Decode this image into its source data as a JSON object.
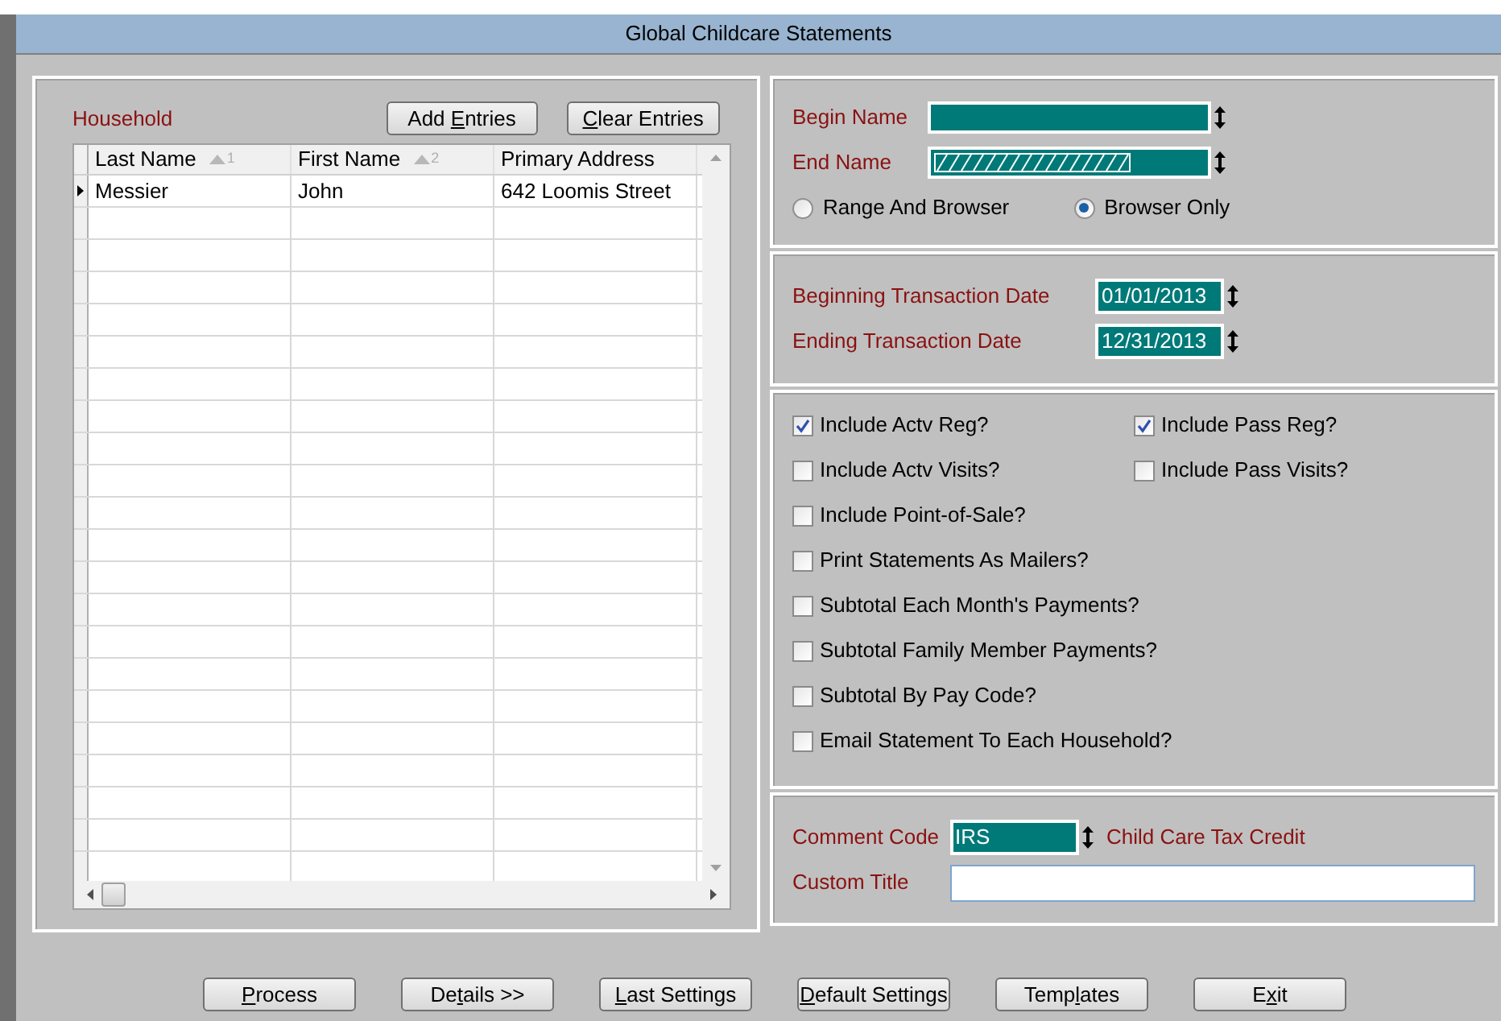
{
  "window": {
    "title": "Global Childcare Statements"
  },
  "household": {
    "label": "Household",
    "buttons": [
      {
        "pre": "Add ",
        "key": "E",
        "post": "ntries"
      },
      {
        "key": "C",
        "post": "lear Entries"
      }
    ],
    "columns": [
      {
        "label": "Last Name",
        "sort": "1"
      },
      {
        "label": "First Name",
        "sort": "2"
      },
      {
        "label": "Primary Address"
      }
    ],
    "rows": [
      {
        "current": true,
        "cells": [
          "Messier",
          "John",
          "642 Loomis Street"
        ]
      }
    ]
  },
  "name_range": {
    "fields": [
      {
        "label": "Begin Name",
        "masked": false
      },
      {
        "label": "End Name",
        "masked": true
      }
    ],
    "options": [
      {
        "label": "Range And Browser",
        "selected": false
      },
      {
        "label": "Browser Only",
        "selected": true
      }
    ]
  },
  "dates": [
    {
      "label": "Beginning Transaction Date",
      "value": "01/01/2013"
    },
    {
      "label": "Ending Transaction Date",
      "value": "12/31/2013"
    }
  ],
  "options": [
    [
      {
        "label": "Include Actv Reg?",
        "checked": true
      },
      {
        "label": "Include Pass Reg?",
        "checked": true
      }
    ],
    [
      {
        "label": "Include Actv Visits?",
        "checked": false
      },
      {
        "label": "Include Pass Visits?",
        "checked": false
      }
    ],
    [
      {
        "label": "Include Point-of-Sale?",
        "checked": false
      }
    ],
    [
      {
        "label": "Print Statements As Mailers?",
        "checked": false
      }
    ],
    [
      {
        "label": "Subtotal Each Month's Payments?",
        "checked": false
      }
    ],
    [
      {
        "label": "Subtotal Family Member Payments?",
        "checked": false
      }
    ],
    [
      {
        "label": "Subtotal By Pay Code?",
        "checked": false
      }
    ],
    [
      {
        "label": "Email Statement To Each Household?",
        "checked": false
      }
    ]
  ],
  "comment": {
    "label": "Comment Code",
    "value": "IRS",
    "description": "Child Care Tax Credit"
  },
  "custom_title": {
    "label": "Custom Title"
  },
  "buttons": [
    {
      "key": "P",
      "post": "rocess"
    },
    {
      "pre": "De",
      "key": "t",
      "post": "ails >>"
    },
    {
      "key": "L",
      "post": "ast Settings"
    },
    {
      "key": "D",
      "post": "efault Settings"
    },
    {
      "pre": "Temp",
      "key": "l",
      "post": "ates"
    },
    {
      "pre": "E",
      "key": "x",
      "post": "it"
    }
  ]
}
